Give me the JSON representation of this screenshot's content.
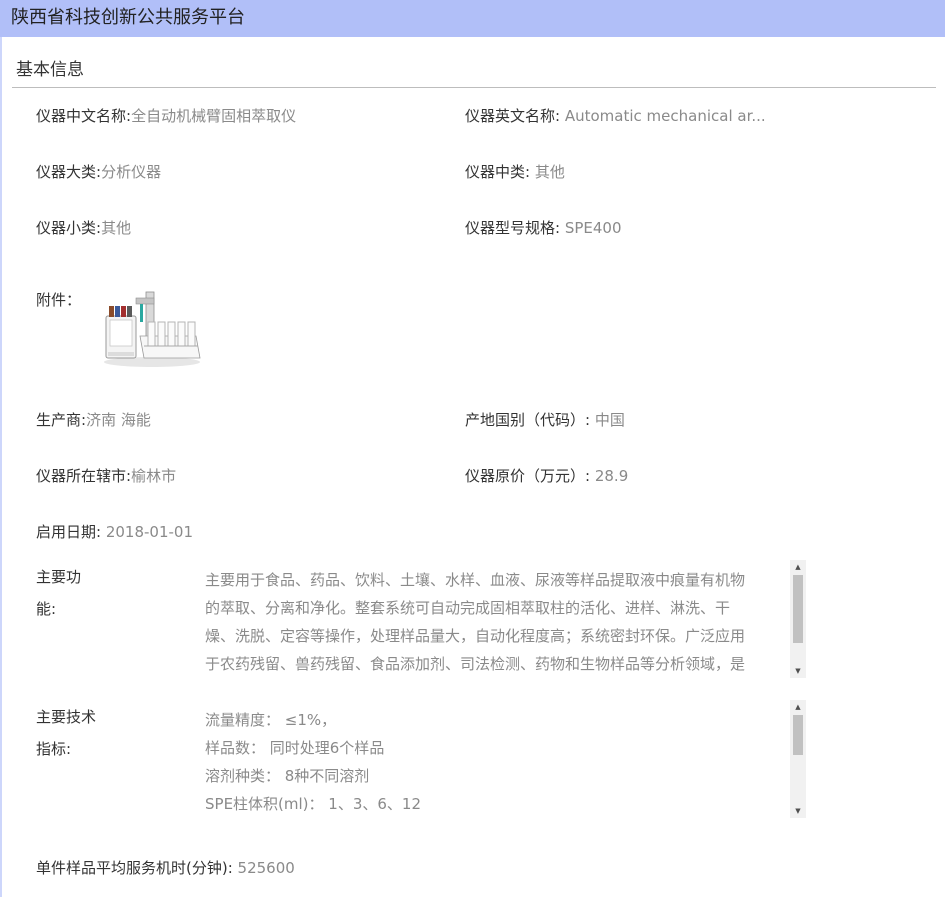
{
  "header": {
    "title": "陕西省科技创新公共服务平台"
  },
  "section": {
    "title": "基本信息"
  },
  "fields": {
    "name_cn": {
      "label": "仪器中文名称:",
      "value": "全自动机械臂固相萃取仪"
    },
    "name_en": {
      "label": "仪器英文名称:",
      "value": "Automatic mechanical ar..."
    },
    "category_major": {
      "label": "仪器大类:",
      "value": "分析仪器"
    },
    "category_mid": {
      "label": "仪器中类:",
      "value": "其他"
    },
    "category_minor": {
      "label": "仪器小类:",
      "value": "其他"
    },
    "model": {
      "label": "仪器型号规格:",
      "value": "SPE400"
    },
    "manufacturer": {
      "label": "生产商:",
      "value": "济南 海能"
    },
    "origin": {
      "label": "产地国别（代码）:",
      "value": "中国"
    },
    "city": {
      "label": "仪器所在辖市:",
      "value": "榆林市"
    },
    "price": {
      "label": "仪器原价（万元）:",
      "value": "28.9"
    },
    "start_date": {
      "label": "启用日期:",
      "value": "2018-01-01"
    },
    "service_time": {
      "label": "单件样品平均服务机时(分钟):",
      "value": "525600"
    }
  },
  "attachment": {
    "label": "附件："
  },
  "main_function": {
    "label_line1": "主要功",
    "label_line2": "能:",
    "lines": [
      "主要用于食品、药品、饮料、土壤、水样、血液、尿液等样品提取液中痕量有机物",
      "的萃取、分离和净化。整套系统可自动完成固相萃取柱的活化、进样、淋洗、干",
      "燥、洗脱、定容等操作，处理样品量大，自动化程度高；系统密封环保。广泛应用",
      "于农药残留、兽药残留、食品添加剂、司法检测、药物和生物样品等分析领域，是"
    ]
  },
  "main_specs": {
    "label_line1": "主要技术",
    "label_line2": "指标:",
    "lines": [
      "流量精度： ≤1%，",
      "样品数： 同时处理6个样品",
      "溶剂种类： 8种不同溶剂",
      "SPE柱体积(ml)： 1、3、6、12"
    ]
  },
  "colors": {
    "header_bg": "#b1bff8",
    "label": "#333333",
    "value": "#8a8a8a"
  }
}
